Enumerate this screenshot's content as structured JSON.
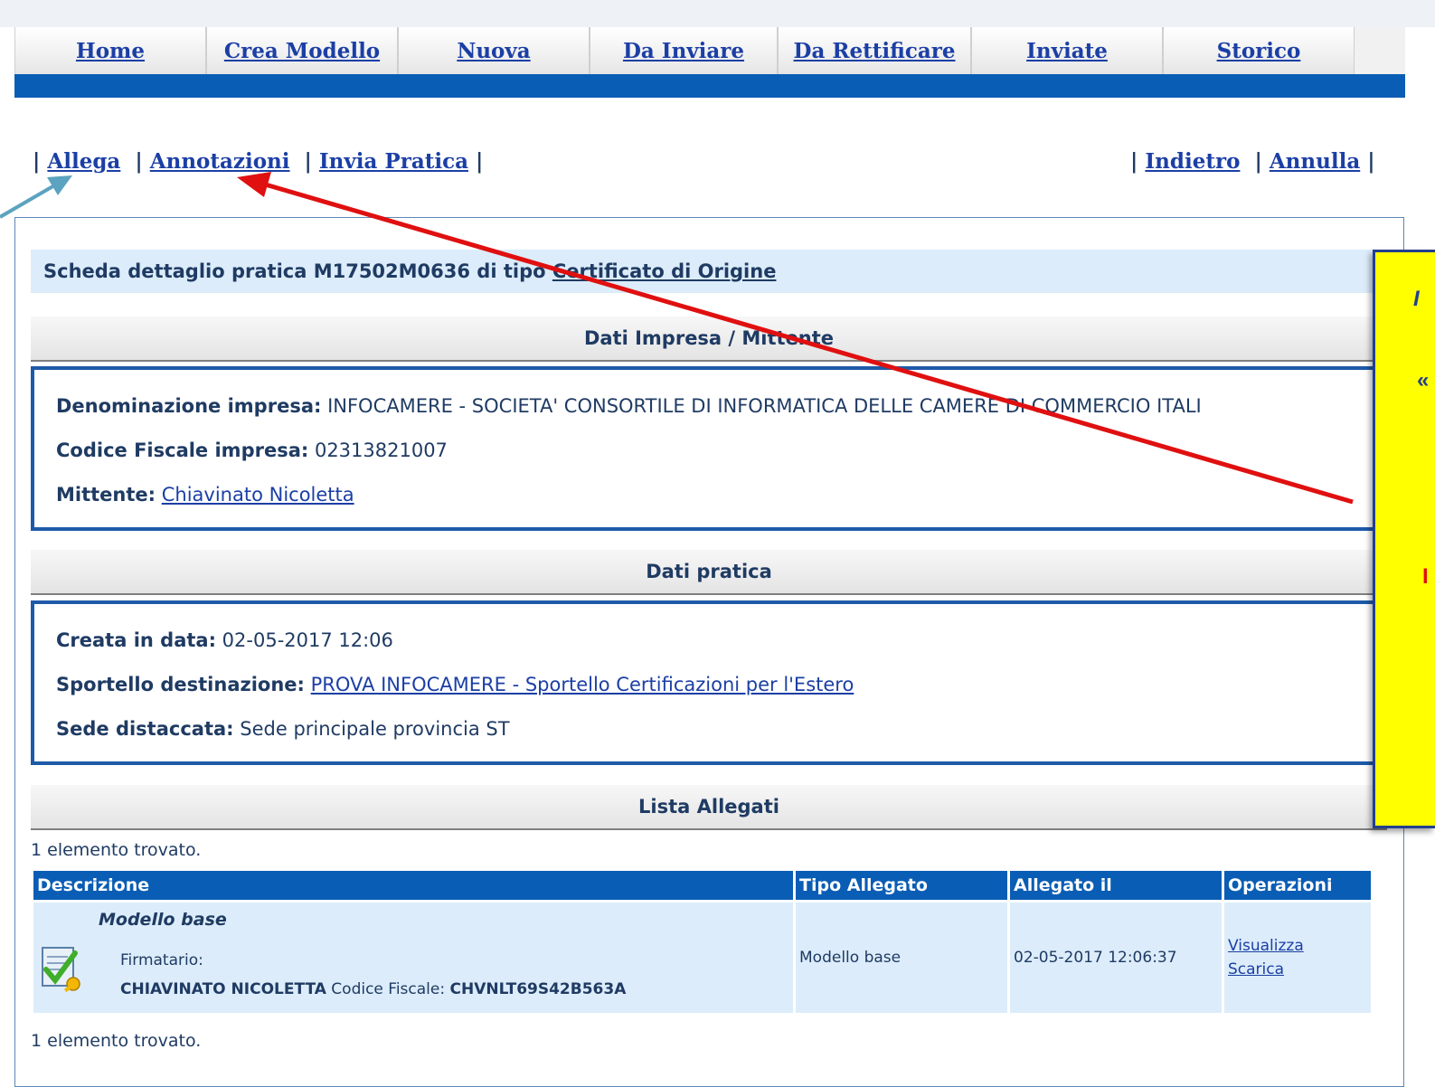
{
  "nav": {
    "tabs": [
      {
        "label": "Home"
      },
      {
        "label": "Crea Modello"
      },
      {
        "label": "Nuova"
      },
      {
        "label": "Da Inviare"
      },
      {
        "label": "Da Rettificare"
      },
      {
        "label": "Inviate"
      },
      {
        "label": "Storico"
      }
    ]
  },
  "actions": {
    "left": {
      "allega": "Allega",
      "annotazioni": "Annotazioni",
      "invia_pratica": "Invia Pratica"
    },
    "right": {
      "indietro": "Indietro",
      "annulla": "Annulla"
    },
    "separator": "|"
  },
  "detail": {
    "title_prefix": "Scheda dettaglio pratica M17502M0636 di tipo ",
    "title_type": "Certificato di Origine"
  },
  "impresa": {
    "section_title": "Dati Impresa / Mittente",
    "denominazione_label": "Denominazione impresa:",
    "denominazione_value": "INFOCAMERE - SOCIETA' CONSORTILE DI INFORMATICA DELLE CAMERE DI COMMERCIO ITALI",
    "cf_label": "Codice Fiscale impresa:",
    "cf_value": "02313821007",
    "mittente_label": "Mittente:",
    "mittente_value": "Chiavinato Nicoletta"
  },
  "pratica": {
    "section_title": "Dati pratica",
    "creata_label": "Creata in data:",
    "creata_value": "02-05-2017 12:06",
    "sportello_label": "Sportello destinazione:",
    "sportello_value": "PROVA INFOCAMERE - Sportello Certificazioni per l'Estero",
    "sede_label": "Sede distaccata:",
    "sede_value": "Sede principale provincia ST"
  },
  "allegati": {
    "section_title": "Lista Allegati",
    "found_text": "1 elemento trovato.",
    "columns": {
      "descrizione": "Descrizione",
      "tipo": "Tipo Allegato",
      "allegato_il": "Allegato il",
      "operazioni": "Operazioni"
    },
    "rows": [
      {
        "title": "Modello base",
        "firmatario_label": "Firmatario:",
        "signer_name": "CHIAVINATO NICOLETTA",
        "cf_label": "Codice Fiscale:",
        "cf_value": "CHVNLT69S42B563A",
        "tipo": "Modello base",
        "data": "02-05-2017 12:06:37",
        "op_visualizza": "Visualizza",
        "op_scarica": "Scarica"
      }
    ]
  },
  "callout": {
    "line1": "I",
    "line2": "«",
    "line3": "I"
  },
  "colors": {
    "nav_blue": "#0a5db4",
    "link_blue": "#1b3fa5",
    "callout_yellow": "#ffff00",
    "arrow_red": "#e01010",
    "arrow_teal": "#5ba3c0"
  }
}
